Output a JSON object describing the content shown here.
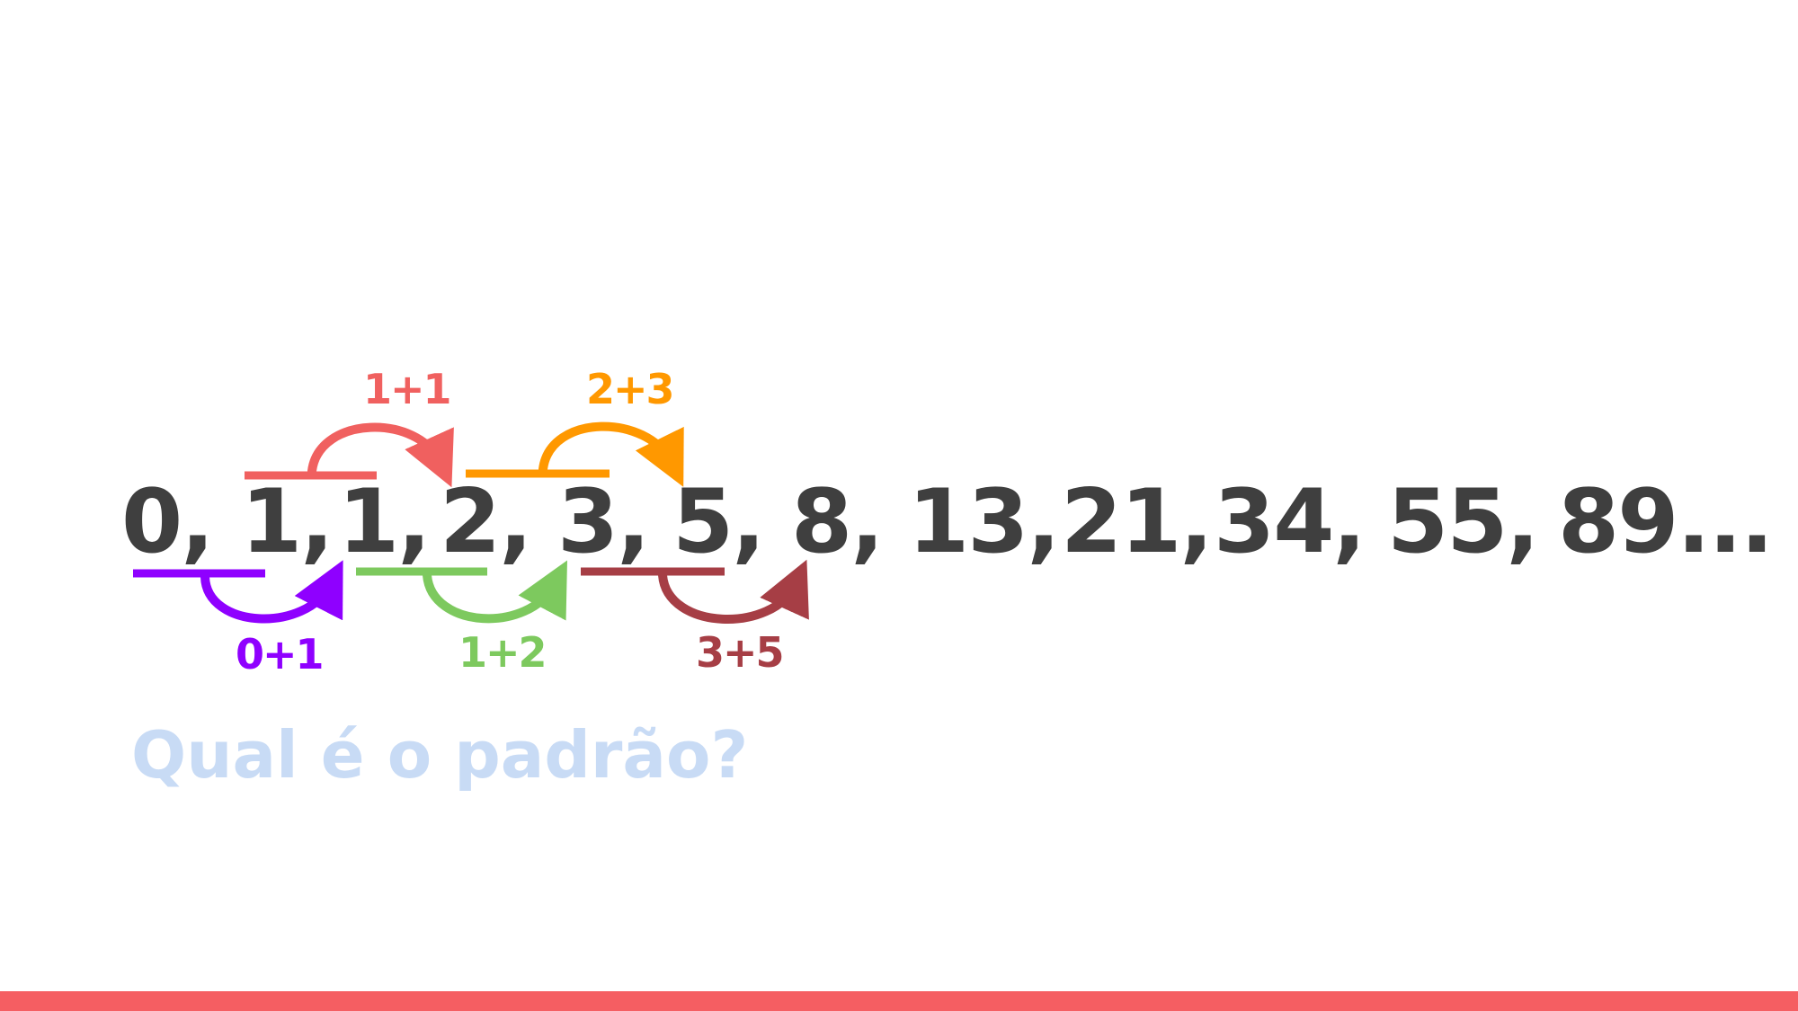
{
  "sequence": {
    "items": [
      "0,",
      "1,",
      "1,",
      "2,",
      "3,",
      "5,",
      "8,",
      "13,",
      "21,",
      "34,",
      "55,",
      "89..."
    ]
  },
  "pairs": {
    "items": [
      {
        "label": "0+1",
        "color": "#8f00ff",
        "position": "below"
      },
      {
        "label": "1+1",
        "color": "#f0605f",
        "position": "above"
      },
      {
        "label": "1+2",
        "color": "#7dc95e",
        "position": "below"
      },
      {
        "label": "2+3",
        "color": "#ff9800",
        "position": "above"
      },
      {
        "label": "3+5",
        "color": "#a63e45",
        "position": "below"
      }
    ]
  },
  "question": {
    "text": "Qual é o padrão?",
    "color": "#c8dbf5"
  },
  "theme": {
    "text_color": "#3f3f3f",
    "accent_bar_color": "#f55e62"
  }
}
